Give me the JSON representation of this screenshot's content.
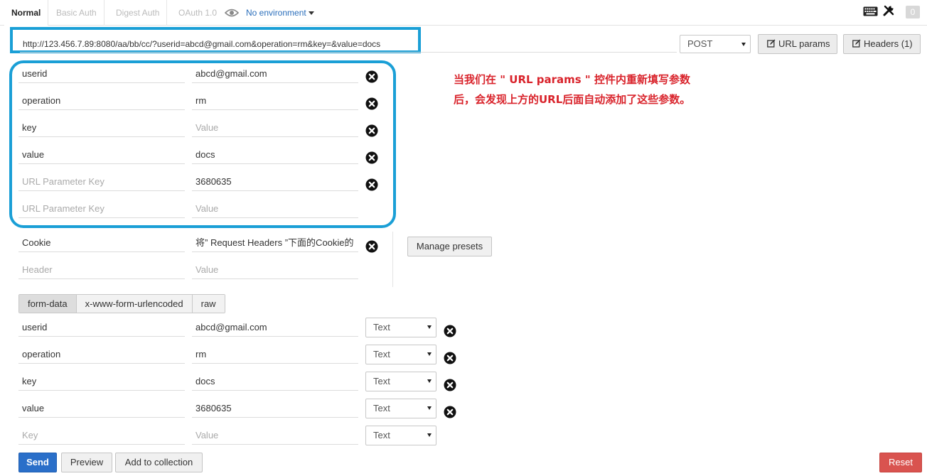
{
  "auth_tabs": [
    {
      "label": "Normal"
    },
    {
      "label": "Basic Auth"
    },
    {
      "label": "Digest Auth"
    },
    {
      "label": "OAuth 1.0"
    }
  ],
  "environment": {
    "label": "No environment"
  },
  "badge_count": "0",
  "request": {
    "url": "http://123.456.7.89:8080/aa/bb/cc/?userid=abcd@gmail.com&operation=rm&key=&value=docs",
    "method": "POST",
    "url_params_label": "URL params",
    "headers_label": "Headers (1)"
  },
  "url_params": [
    {
      "key": "userid",
      "value": "abcd@gmail.com"
    },
    {
      "key": "operation",
      "value": "rm"
    },
    {
      "key": "key",
      "value": "",
      "value_placeholder": "Value"
    },
    {
      "key": "value",
      "value": "docs"
    },
    {
      "key": "",
      "key_placeholder": "URL Parameter Key",
      "value": "3680635"
    },
    {
      "key": "",
      "key_placeholder": "URL Parameter Key",
      "value": "",
      "value_placeholder": "Value"
    }
  ],
  "annotation": {
    "line1": "当我们在 \" URL params \" 控件内重新填写参数",
    "line2": "后，会发现上方的URL后面自动添加了这些参数。"
  },
  "headers": [
    {
      "key": "Cookie",
      "value": "将” Request Headers ”下面的Cookie的"
    },
    {
      "key": "",
      "key_placeholder": "Header",
      "value": "",
      "value_placeholder": "Value"
    }
  ],
  "manage_presets_label": "Manage presets",
  "body_tabs": [
    {
      "label": "form-data"
    },
    {
      "label": "x-www-form-urlencoded"
    },
    {
      "label": "raw"
    }
  ],
  "form_data": [
    {
      "key": "userid",
      "value": "abcd@gmail.com",
      "type": "Text"
    },
    {
      "key": "operation",
      "value": "rm",
      "type": "Text"
    },
    {
      "key": "key",
      "value": "docs",
      "type": "Text"
    },
    {
      "key": "value",
      "value": "3680635",
      "type": "Text"
    },
    {
      "key": "",
      "key_placeholder": "Key",
      "value": "",
      "value_placeholder": "Value",
      "type": "Text"
    }
  ],
  "actions": {
    "send": "Send",
    "preview": "Preview",
    "add_to_collection": "Add to collection",
    "reset": "Reset"
  },
  "colors": {
    "highlight_border": "#1a9fd6",
    "annotation_text": "#d9232b",
    "send_button": "#2a6fc9",
    "reset_button": "#d9534f",
    "environment_link": "#2a6ebb"
  },
  "icons": {
    "visibility": "eye-icon",
    "keyboard": "keyboard-icon",
    "settings": "wrench-icon",
    "remove_row": "circle-x-icon",
    "toggle_edit": "edit-icon"
  }
}
